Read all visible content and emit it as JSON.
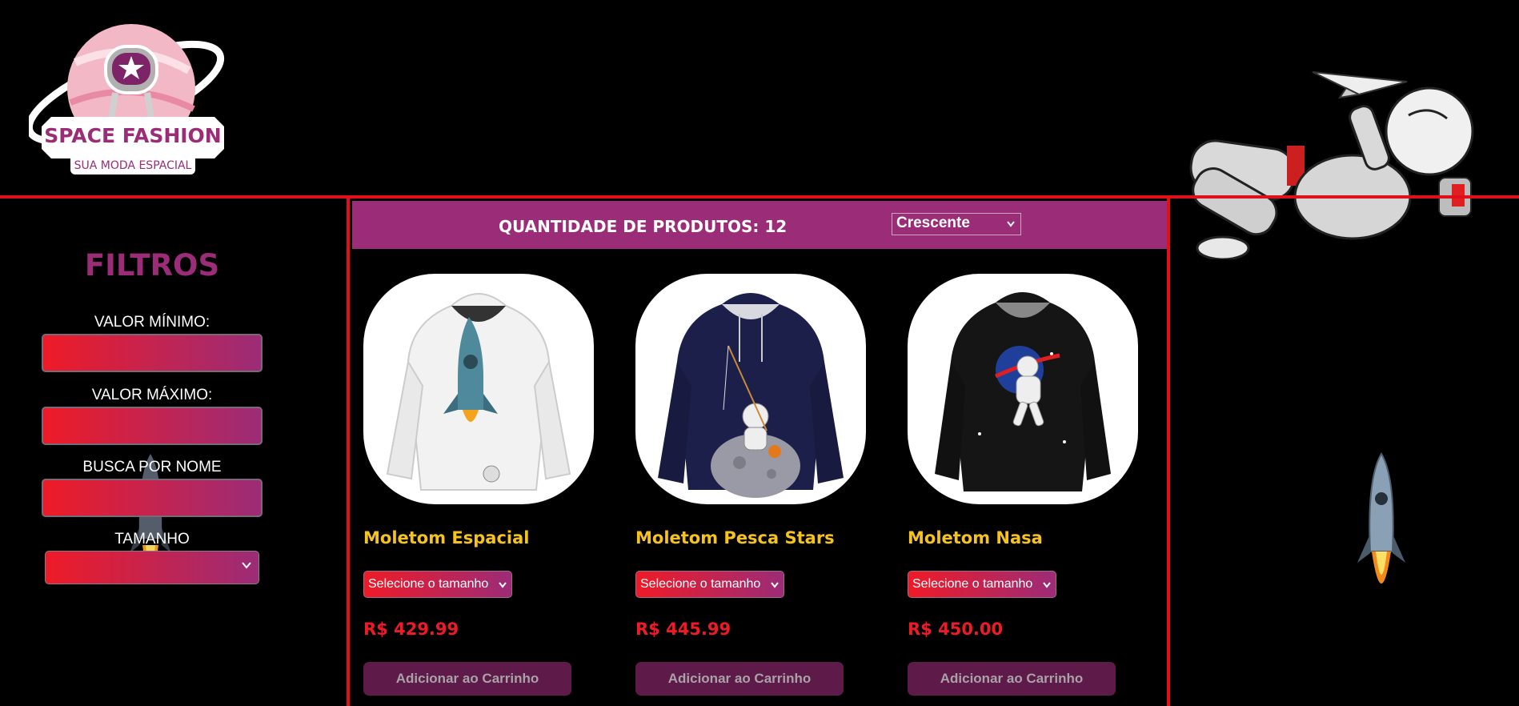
{
  "brand": {
    "name": "SPACE FASHION",
    "tagline": "SUA MODA ESPACIAL",
    "primary": "#9b2c77",
    "accent": "#ee1b27",
    "highlight": "#f6c21f"
  },
  "filters": {
    "title": "FILTROS",
    "min_label": "VALOR MÍNIMO:",
    "max_label": "VALOR MÁXIMO:",
    "name_label": "BUSCA POR NOME",
    "size_label": "TAMANHO"
  },
  "toolbar": {
    "count_text": "QUANTIDADE DE PRODUTOS: 12",
    "sort_selected": "Crescente"
  },
  "products": [
    {
      "name": "Moletom Espacial",
      "size_placeholder": "Selecione o tamanho",
      "price": "R$ 429.99",
      "add_label": "Adicionar ao Carrinho",
      "image": "white-hoodie-rocket"
    },
    {
      "name": "Moletom Pesca Stars",
      "size_placeholder": "Selecione o tamanho",
      "price": "R$ 445.99",
      "add_label": "Adicionar ao Carrinho",
      "image": "navy-hoodie-astronaut-fishing"
    },
    {
      "name": "Moletom Nasa",
      "size_placeholder": "Selecione o tamanho",
      "price": "R$ 450.00",
      "add_label": "Adicionar ao Carrinho",
      "image": "black-hoodie-nasa-astronaut"
    }
  ],
  "icons": [
    "chevron-down-icon",
    "astronaut-logo-icon",
    "flying-astronaut-illustration",
    "rocket-illustration"
  ]
}
